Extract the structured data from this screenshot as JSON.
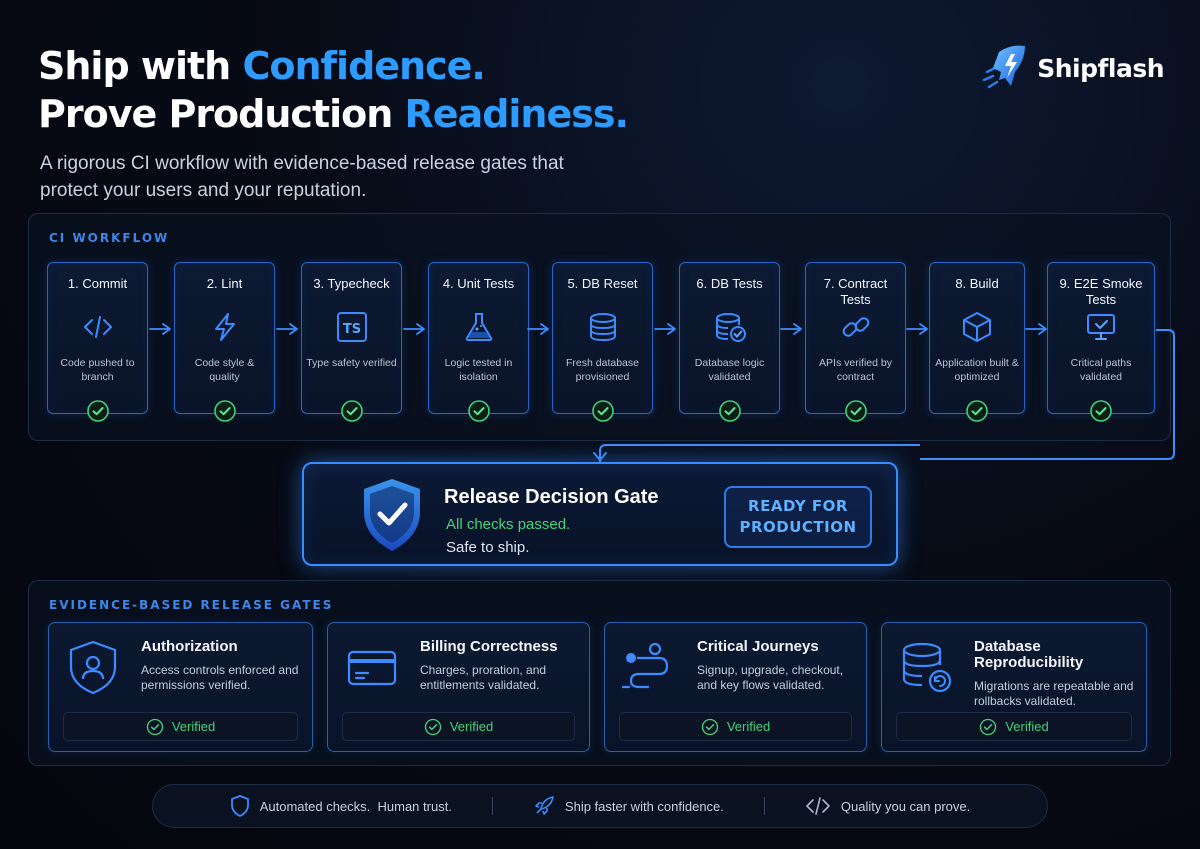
{
  "hero": {
    "line1_pre": "Ship with ",
    "line1_accent": "Confidence.",
    "line2_pre": "Prove Production ",
    "line2_accent": "Readiness.",
    "subtitle": "A rigorous CI workflow with evidence-based release gates that protect your users and your reputation."
  },
  "brand": {
    "name": "Shipflash",
    "icon": "lightning-rocket-logo"
  },
  "colors": {
    "accent": "#2e9bff",
    "success": "#47d47a",
    "border": "#2a66c9",
    "background": "#05080f"
  },
  "workflow": {
    "label": "CI WORKFLOW",
    "steps": [
      {
        "title": "1. Commit",
        "desc": "Code pushed to branch",
        "icon": "code-icon"
      },
      {
        "title": "2. Lint",
        "desc": "Code style & quality",
        "icon": "lightning-icon"
      },
      {
        "title": "3. Typecheck",
        "desc": "Type safety verified",
        "icon": "ts-icon"
      },
      {
        "title": "4. Unit Tests",
        "desc": "Logic tested in isolation",
        "icon": "flask-icon"
      },
      {
        "title": "5. DB Reset",
        "desc": "Fresh database provisioned",
        "icon": "database-icon"
      },
      {
        "title": "6. DB Tests",
        "desc": "Database logic validated",
        "icon": "database-check-icon"
      },
      {
        "title": "7. Contract Tests",
        "desc": "APIs verified by contract",
        "icon": "link-icon"
      },
      {
        "title": "8. Build",
        "desc": "Application built & optimized",
        "icon": "cube-icon"
      },
      {
        "title": "9. E2E Smoke Tests",
        "desc": "Critical paths validated",
        "icon": "monitor-check-icon"
      }
    ]
  },
  "gate": {
    "title": "Release Decision Gate",
    "status": "All checks passed.",
    "note": "Safe to ship.",
    "button": "READY FOR PRODUCTION",
    "icon": "shield-check-icon"
  },
  "evidence": {
    "label": "EVIDENCE-BASED RELEASE GATES",
    "cards": [
      {
        "title": "Authorization",
        "desc": "Access controls enforced and permissions verified.",
        "status": "Verified",
        "icon": "shield-user-icon"
      },
      {
        "title": "Billing Correctness",
        "desc": "Charges, proration, and entitlements validated.",
        "status": "Verified",
        "icon": "credit-card-icon"
      },
      {
        "title": "Critical Journeys",
        "desc": "Signup, upgrade, checkout, and key flows validated.",
        "status": "Verified",
        "icon": "route-icon"
      },
      {
        "title": "Database Reproducibility",
        "desc": "Migrations are repeatable and rollbacks validated.",
        "status": "Verified",
        "icon": "database-refresh-icon"
      }
    ]
  },
  "footer": {
    "items": [
      {
        "text": "Automated checks.  Human trust.",
        "icon": "shield-icon"
      },
      {
        "text": "Ship faster with confidence.",
        "icon": "rocket-icon"
      },
      {
        "text": "Quality you can prove.",
        "icon": "code-icon"
      }
    ]
  }
}
